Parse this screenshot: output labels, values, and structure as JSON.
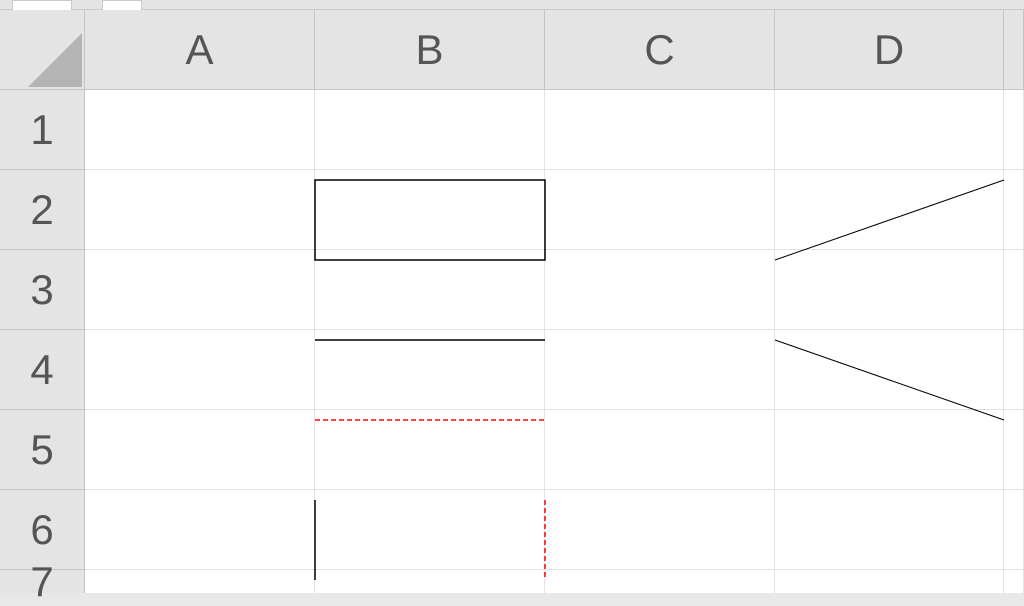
{
  "columns": [
    "A",
    "B",
    "C",
    "D"
  ],
  "rows": [
    "1",
    "2",
    "3",
    "4",
    "5",
    "6",
    "7"
  ],
  "cells": {},
  "formatting": {
    "B2": {
      "border": "solid-black-all"
    },
    "B4": {
      "border_top": "solid-black",
      "border_bottom": "dashed-red"
    },
    "B6": {
      "border_left": "solid-black",
      "border_right": "dashed-red"
    },
    "D2": {
      "diagonal": "up",
      "stroke": "#000000"
    },
    "D4": {
      "diagonal": "down",
      "stroke": "#000000"
    }
  },
  "colors": {
    "header_bg": "#e4e4e4",
    "grid_line": "#e2e2e2",
    "border_black": "#000000",
    "border_red": "#ff0000"
  }
}
